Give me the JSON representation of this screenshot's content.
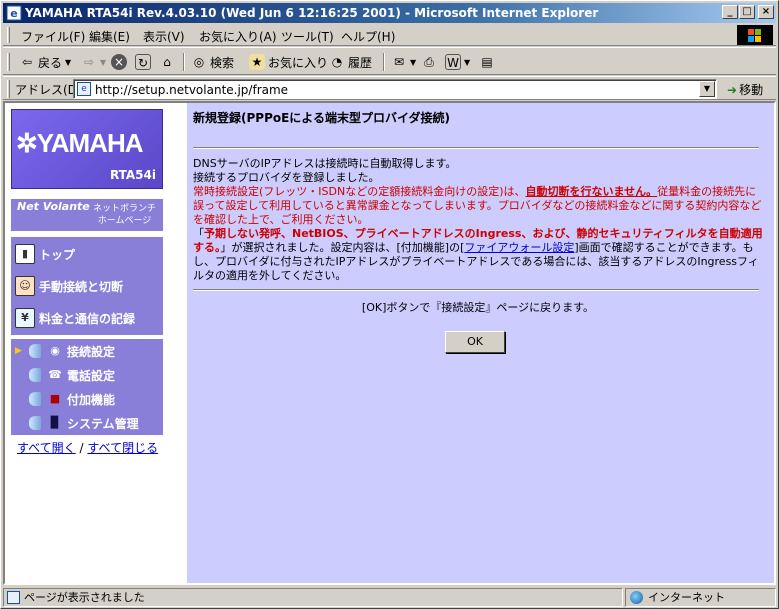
{
  "window": {
    "title": "YAMAHA RTA54i Rev.4.03.10 (Wed Jun 6 12:16:25 2001) - Microsoft Internet Explorer"
  },
  "menubar": {
    "items": [
      "ファイル(F)",
      "編集(E)",
      "表示(V)",
      "お気に入り(A)",
      "ツール(T)",
      "ヘルプ(H)"
    ]
  },
  "toolbar": {
    "back": "戻る",
    "search": "検索",
    "favorites": "お気に入り",
    "history": "履歴"
  },
  "address": {
    "label": "アドレス(D)",
    "url": "http://setup.netvolante.jp/frame",
    "go": "移動"
  },
  "sidebar": {
    "logo_text": "YAMAHA",
    "model": "RTA54i",
    "netvolante_logo": "Net Volante",
    "netvolante_sub_1": "ネットボランチ",
    "netvolante_sub_2": "ホームページ",
    "nav": [
      "トップ",
      "手動接続と切断",
      "料金と通信の記録"
    ],
    "sub": [
      "接続設定",
      "電話設定",
      "付加機能",
      "システム管理"
    ],
    "open_all": "すべて開く",
    "slash": "/",
    "close_all": "すべて閉じる"
  },
  "content": {
    "title": "新規登録(PPPoEによる端末型プロバイダ接続)",
    "line1": "DNSサーバのIPアドレスは接続時に自動取得します。",
    "line2": "接続するプロバイダを登録しました。",
    "warn_a": "常時接続設定(フレッツ・ISDNなどの定額接続料金向けの設定)は、",
    "warn_b": "自動切断を行ないません。",
    "warn_c": "従量料金の接続先に誤って設定して利用していると異常課金となってしまいます。プロバイダなどの接続料金などに関する契約内容などを確認した上で、ご利用ください。",
    "filter_open": "「",
    "filter_bold": "予期しない発呼、NetBIOS、プライベートアドレスのIngress、および、静的セキュリティフィルタを自動適用する。",
    "filter_a": "」が選択されました。設定内容は、[付加機能]の[",
    "filter_link": "ファイアウォール設定",
    "filter_b": "]画面で確認することができます。もし、プロバイダに付与されたIPアドレスがプライベートアドレスである場合には、該当するアドレスのIngressフィルタの適用を外してください。",
    "return_msg": "[OK]ボタンで『接続設定』ページに戻ります。",
    "ok": "OK"
  },
  "status": {
    "text": "ページが表示されました",
    "zone": "インターネット"
  }
}
